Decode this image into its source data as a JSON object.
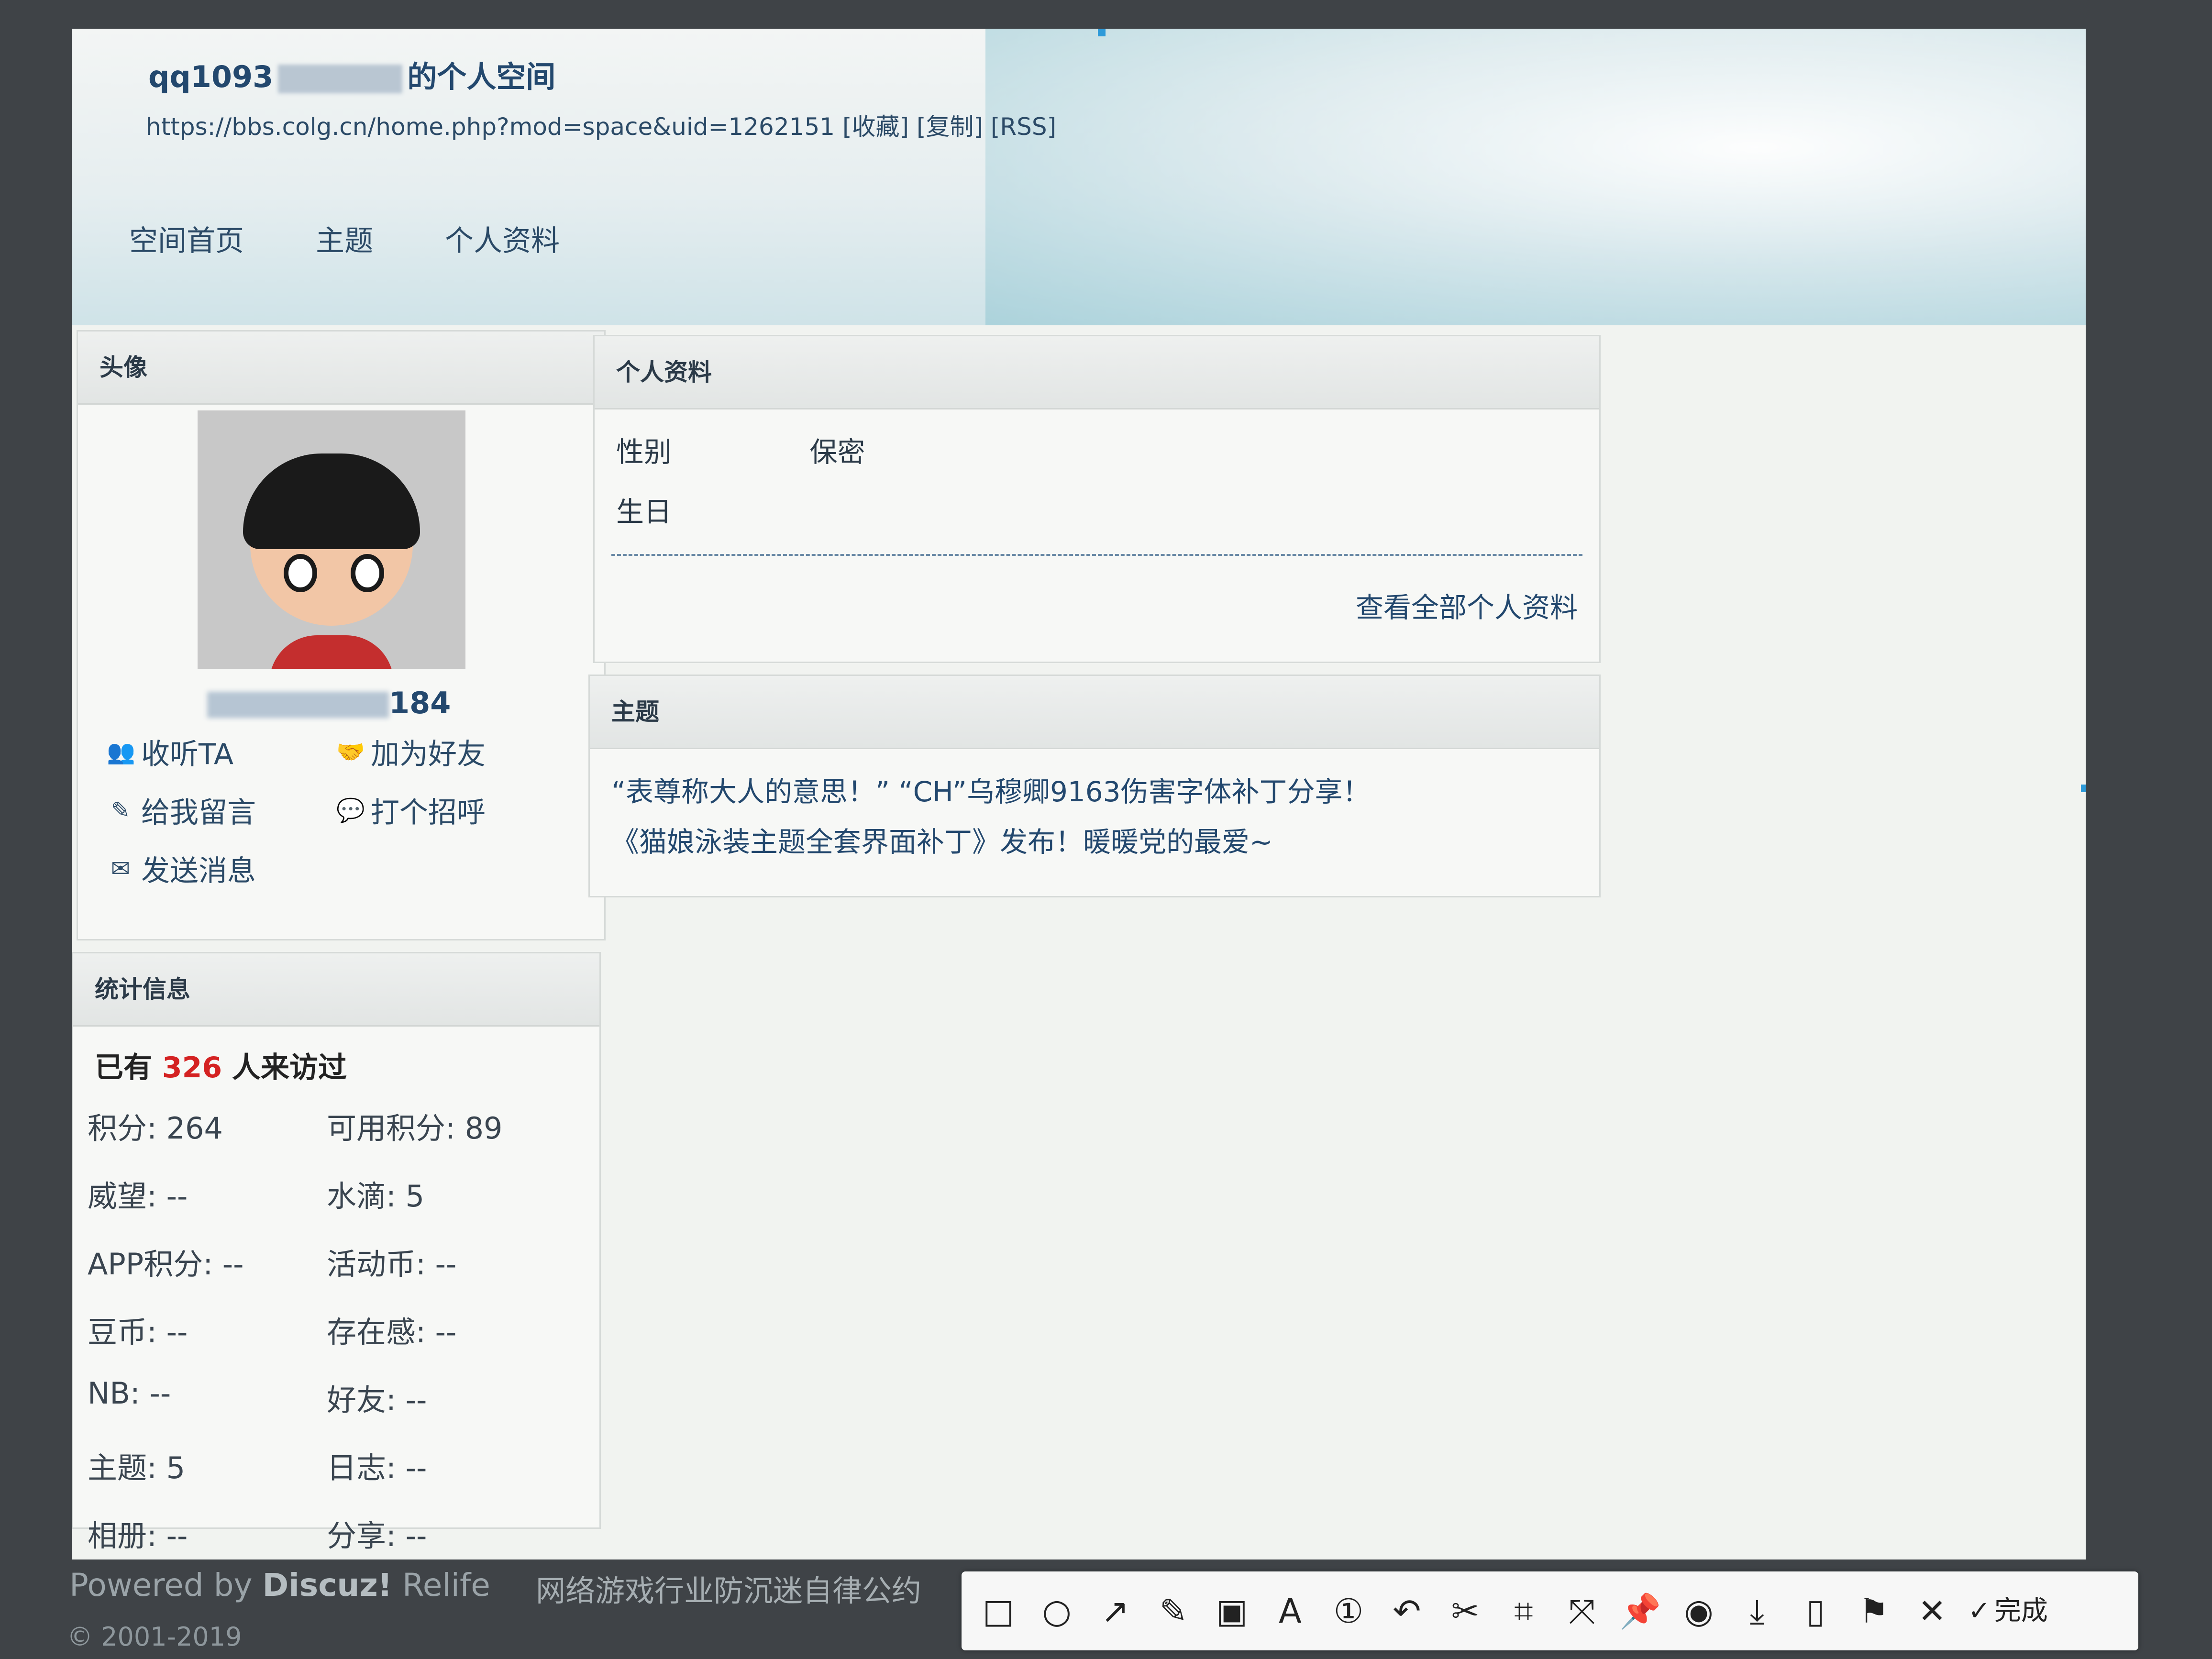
{
  "header": {
    "title_prefix": "qq1093",
    "title_suffix": "的个人空间",
    "url": "https://bbs.colg.cn/home.php?mod=space&uid=1262151",
    "links": [
      "[收藏]",
      "[复制]",
      "[RSS]"
    ]
  },
  "nav": [
    "空间首页",
    "主题",
    "个人资料"
  ],
  "avatar_panel": {
    "title": "头像",
    "username_suffix": "184",
    "actions": [
      {
        "icon": "listen-icon",
        "glyph": "👥",
        "label": "收听TA"
      },
      {
        "icon": "add-friend-icon",
        "glyph": "🤝",
        "label": "加为好友"
      },
      {
        "icon": "pencil-icon",
        "glyph": "✎",
        "label": "给我留言"
      },
      {
        "icon": "greet-icon",
        "glyph": "💬",
        "label": "打个招呼"
      },
      {
        "icon": "mail-icon",
        "glyph": "✉",
        "label": "发送消息"
      }
    ]
  },
  "stats_panel": {
    "title": "统计信息",
    "visits_prefix": "已有",
    "visits_count": "326",
    "visits_suffix": "人来访过",
    "items": [
      "积分: 264",
      "可用积分: 89",
      "威望: --",
      "水滴: 5",
      "APP积分: --",
      "活动币: --",
      "豆币: --",
      "存在感: --",
      "NB: --",
      "好友: --",
      "主题: 5",
      "日志: --",
      "相册: --",
      "分享: --"
    ]
  },
  "profile_panel": {
    "title": "个人资料",
    "gender_label": "性别",
    "gender_value": "保密",
    "birthday_label": "生日",
    "view_all": "查看全部个人资料"
  },
  "threads_panel": {
    "title": "主题",
    "threads": [
      "“表尊称大人的意思！”   “CH”乌穆卿9163伤害字体补丁分享！",
      "《猫娘泳装主题全套界面补丁》发布！暖暖党的最爱~"
    ]
  },
  "footer": {
    "powered_prefix": "Powered by",
    "brand": "Discuz!",
    "suffix": "Relife",
    "copyright": "© 2001-2019",
    "link": "网络游戏行业防沉迷自律公约"
  },
  "toolbar": {
    "tools": [
      {
        "icon": "rectangle-icon",
        "glyph": "□"
      },
      {
        "icon": "circle-icon",
        "glyph": "○"
      },
      {
        "icon": "arrow-icon",
        "glyph": "↗"
      },
      {
        "icon": "pen-icon",
        "glyph": "✎"
      },
      {
        "icon": "mosaic-icon",
        "glyph": "▣"
      },
      {
        "icon": "text-icon",
        "glyph": "A"
      },
      {
        "icon": "number-icon",
        "glyph": "①"
      },
      {
        "icon": "undo-icon",
        "glyph": "↶"
      },
      {
        "icon": "scissors-icon",
        "glyph": "✂"
      },
      {
        "icon": "translate-icon",
        "glyph": "⌗"
      },
      {
        "icon": "expand-icon",
        "glyph": "⤧"
      },
      {
        "icon": "pin-icon",
        "glyph": "📌"
      },
      {
        "icon": "record-icon",
        "glyph": "◉"
      },
      {
        "icon": "download-icon",
        "glyph": "⤓"
      },
      {
        "icon": "phone-icon",
        "glyph": "▯"
      },
      {
        "icon": "bookmark-icon",
        "glyph": "⚑"
      },
      {
        "icon": "close-icon",
        "glyph": "✕"
      }
    ],
    "done_glyph": "✓",
    "done_label": "完成"
  }
}
